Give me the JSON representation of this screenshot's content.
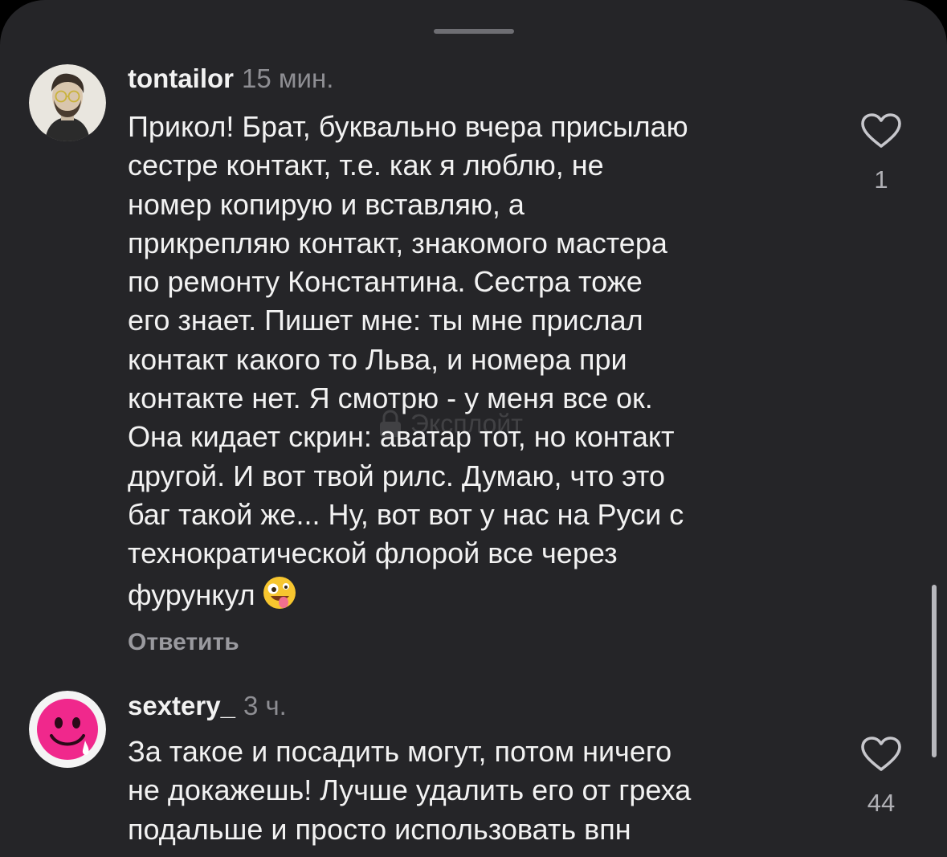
{
  "comments": [
    {
      "username": "tontailor",
      "time": "15 мин.",
      "text": "Прикол! Брат, буквально вчера присылаю\nсестре контакт, т.е. как я люблю, не\nномер копирую и вставляю, а\nприкрепляю контакт, знакомого мастера\nпо ремонту Константина. Сестра тоже\nего знает. Пишет мне: ты мне прислал\nконтакт какого то Льва, и номера при\nконтакте нет. Я смотрю - у меня все ок.\nОна кидает скрин: аватар тот, но контакт\nдругой. И вот твой рилс. Думаю, что это\nбаг такой же...  Ну, вот вот у нас на Руси с\nтехнократической флорой все через\nфурункул",
      "emoji": "zany-face",
      "likes": "1",
      "reply_label": "Ответить"
    },
    {
      "username": "sextery_",
      "time": "3 ч.",
      "text": "За такое и посадить могут, потом ничего\nне докажешь! Лучше удалить его от греха\nподальше и просто использовать впн",
      "likes": "44"
    }
  ],
  "watermark": "Эксплойт",
  "colors": {
    "background": "#252528",
    "text_primary": "#f2f2f2",
    "text_secondary": "#8e8e93",
    "avatar2_pink": "#f0288c"
  }
}
